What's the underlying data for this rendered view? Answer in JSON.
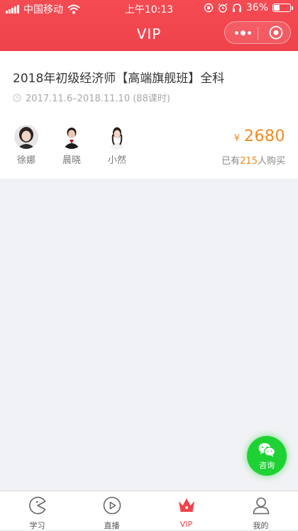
{
  "status_bar": {
    "carrier": "中国移动",
    "time": "上午10:13",
    "battery": "36%",
    "battery_level": 0.36
  },
  "nav": {
    "title": "VIP"
  },
  "course": {
    "title": "2018年初级经济师【高端旗舰班】全科",
    "schedule": "2017.11.6–2018.11.10 (88课时)",
    "teachers": [
      {
        "name": "徐娜"
      },
      {
        "name": "晨晓"
      },
      {
        "name": "小然"
      }
    ],
    "price_symbol": "¥",
    "price": "2680",
    "bought_prefix": "已有",
    "bought_count": "215",
    "bought_suffix": "人购买"
  },
  "consult": {
    "label": "咨询",
    "icon": "wechat-icon"
  },
  "tabs": [
    {
      "label": "学习",
      "icon": "pacman-icon",
      "active": false
    },
    {
      "label": "直播",
      "icon": "play-circle-icon",
      "active": false
    },
    {
      "label": "VIP",
      "icon": "crown-icon",
      "active": true
    },
    {
      "label": "我的",
      "icon": "user-icon",
      "active": false
    }
  ],
  "colors": {
    "brand_red": "#f0434c",
    "price_orange": "#f08a1f",
    "wechat_green": "#1ed234"
  }
}
